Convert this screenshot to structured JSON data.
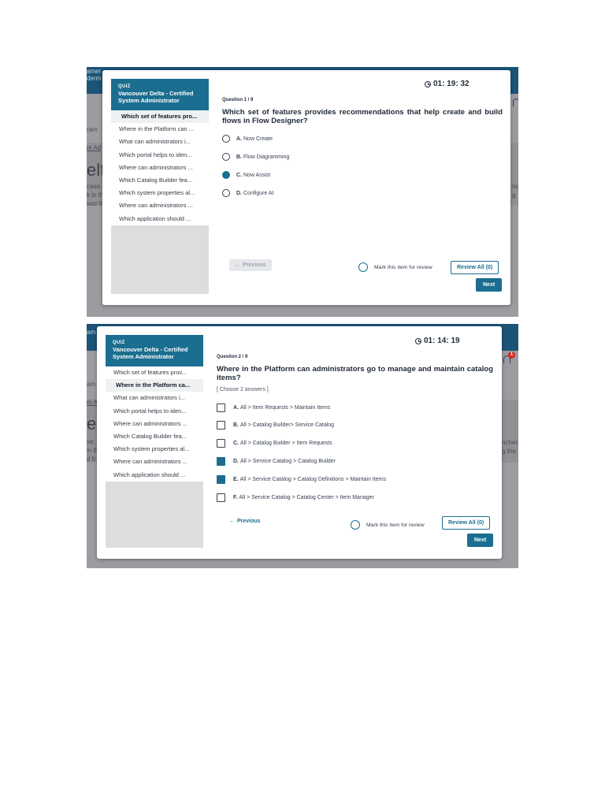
{
  "background": {
    "left_text_1": [
      "amer",
      "derm"
    ],
    "left_text_2": [
      "ram",
      "m Ad",
      "elt",
      "case,",
      "k in th",
      "sed fr"
    ],
    "left_text_3": [
      "am",
      "m Ad",
      "elt",
      "se,",
      "in th",
      "d fr"
    ],
    "right_text_1": [
      "nc",
      "g"
    ],
    "right_text_2": [
      "nchec",
      "g the"
    ]
  },
  "quiz": {
    "label": "QUIZ",
    "title": "Vancouver Delta - Certified System Administrator",
    "questions": [
      "Which set of features pro...",
      "Where in the Platform can ...",
      "What can administrators i...",
      "Which portal helps to iden...",
      "Where can administrators ...",
      "Which Catalog Builder fea...",
      "Which system properties al...",
      "Where can administrators ...",
      "Which application should ..."
    ],
    "questions_2": [
      "Which set of features prov...",
      "Where in the Platform ca...",
      "What can administrators i...",
      "Which portal helps to iden...",
      "Where can administrators ...",
      "Which Catalog Builder fea...",
      "Which system properties al...",
      "Where can administrators ...",
      "Which application should ..."
    ]
  },
  "screen1": {
    "timer": "01: 19: 32",
    "question_number": "Question 1 / 9",
    "question": "Which set of features provides recommendations that help create and build flows in Flow Designer?",
    "options": [
      {
        "letter": "A.",
        "text": "Now Create",
        "selected": false
      },
      {
        "letter": "B.",
        "text": "Flow Diagramming",
        "selected": false
      },
      {
        "letter": "C.",
        "text": "Now Assist",
        "selected": true
      },
      {
        "letter": "D.",
        "text": "Configure AI",
        "selected": false
      }
    ],
    "previous": "Previous",
    "mark_review": "Mark this item for review",
    "review_all": "Review All (0)",
    "next": "Next"
  },
  "screen2": {
    "timer": "01: 14: 19",
    "question_number": "Question 2 / 9",
    "question": "Where in the Platform can administrators go to manage and maintain catalog items?",
    "note": "[ Choose 2 answers ]",
    "options": [
      {
        "letter": "A.",
        "text": "All > Item Requests > Maintain Items",
        "selected": false
      },
      {
        "letter": "B.",
        "text": "All > Catalog Builder> Service Catalog",
        "selected": false
      },
      {
        "letter": "C.",
        "text": "All > Catalog Builder > Item Requests",
        "selected": false
      },
      {
        "letter": "D.",
        "text": "All > Service Catalog > Catalog Builder",
        "selected": true
      },
      {
        "letter": "E.",
        "text": "All > Service Catalog > Catalog Definitions > Maintain Items",
        "selected": true
      },
      {
        "letter": "F.",
        "text": "All > Service Catalog > Catalog Center > Item Manager",
        "selected": false
      }
    ],
    "previous": "Previous",
    "mark_review": "Mark this item for review",
    "review_all": "Review All (0)",
    "next": "Next",
    "notification_count": "1"
  }
}
